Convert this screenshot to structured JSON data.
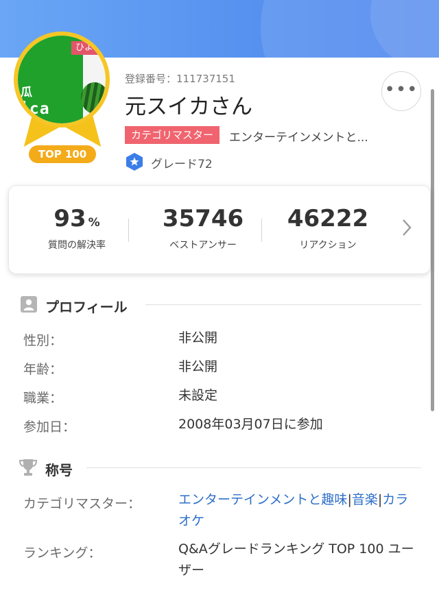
{
  "header": {
    "avatar": {
      "banner_text": "ひよ",
      "text_line1": "瓜",
      "text_line2": "ica",
      "rank_badge": "TOP 100"
    },
    "registration": "登録番号：111737151",
    "username": "元スイカさん",
    "category_badge": "カテゴリマスター",
    "category_text": "エンターテインメントと...",
    "grade": "グレード72",
    "more_button": "•••"
  },
  "stats": [
    {
      "value": "93",
      "unit": "%",
      "label": "質問の解決率"
    },
    {
      "value": "35746",
      "unit": "",
      "label": "ベストアンサー"
    },
    {
      "value": "46222",
      "unit": "",
      "label": "リアクション"
    }
  ],
  "profile": {
    "title": "プロフィール",
    "rows": [
      {
        "label": "性別：",
        "value": "非公開"
      },
      {
        "label": "年齢：",
        "value": "非公開"
      },
      {
        "label": "職業：",
        "value": "未設定"
      },
      {
        "label": "参加日：",
        "value": "2008年03月07日に参加"
      }
    ]
  },
  "titles": {
    "title": "称号",
    "category_label": "カテゴリマスター：",
    "category_links": [
      "エンターテインメントと趣味",
      "音楽",
      "カラオケ"
    ],
    "separator": "|",
    "ranking_label": "ランキング：",
    "ranking_value": "Q&Aグレードランキング TOP 100 ユーザー"
  },
  "colors": {
    "header_blue": "#5792f0",
    "badge_red": "#f0646f",
    "gold": "#f4ab1a",
    "link_blue": "#2d6fc9"
  }
}
